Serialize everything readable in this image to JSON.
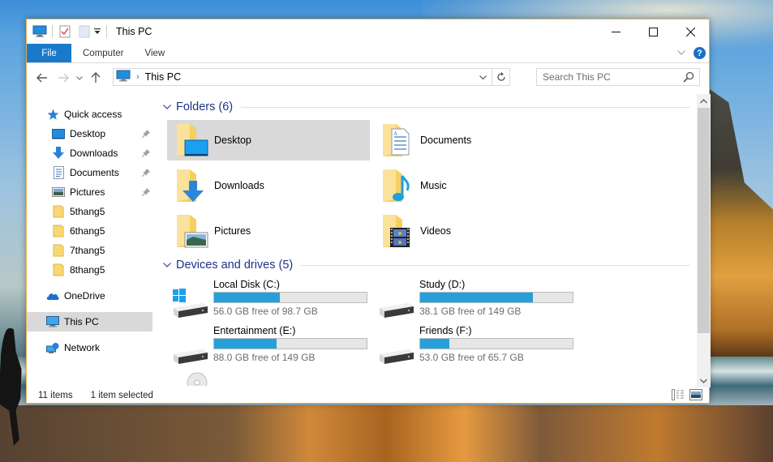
{
  "window": {
    "title": "This PC",
    "controls": {
      "minimize": "—",
      "maximize": "☐",
      "close": "✕"
    }
  },
  "ribbon": {
    "tabs": [
      {
        "label": "File",
        "active": true
      },
      {
        "label": "Computer"
      },
      {
        "label": "View"
      }
    ],
    "help_label": "?"
  },
  "address": {
    "breadcrumb": [
      "This PC"
    ],
    "search_placeholder": "Search This PC"
  },
  "navpane": {
    "quick_access": {
      "label": "Quick access"
    },
    "pinned": [
      {
        "label": "Desktop",
        "icon": "desktop-icon"
      },
      {
        "label": "Downloads",
        "icon": "download-arrow-icon"
      },
      {
        "label": "Documents",
        "icon": "document-icon"
      },
      {
        "label": "Pictures",
        "icon": "picture-icon"
      }
    ],
    "recent_folders": [
      {
        "label": "5thang5"
      },
      {
        "label": "6thang5"
      },
      {
        "label": "7thang5"
      },
      {
        "label": "8thang5"
      }
    ],
    "onedrive": {
      "label": "OneDrive"
    },
    "this_pc": {
      "label": "This PC",
      "selected": true
    },
    "network": {
      "label": "Network"
    }
  },
  "content": {
    "folders_group": {
      "title": "Folders (6)"
    },
    "folders": [
      {
        "label": "Desktop",
        "selected": true,
        "overlay": "desktop"
      },
      {
        "label": "Documents",
        "overlay": "document"
      },
      {
        "label": "Downloads",
        "overlay": "download"
      },
      {
        "label": "Music",
        "overlay": "music"
      },
      {
        "label": "Pictures",
        "overlay": "picture"
      },
      {
        "label": "Videos",
        "overlay": "video"
      }
    ],
    "drives_group": {
      "title": "Devices and drives (5)"
    },
    "drives": [
      {
        "name": "Local Disk (C:)",
        "free_text": "56.0 GB free of 98.7 GB",
        "used_fraction": 0.43,
        "system": true
      },
      {
        "name": "Study (D:)",
        "free_text": "38.1 GB free of 149 GB",
        "used_fraction": 0.74
      },
      {
        "name": "Entertainment (E:)",
        "free_text": "88.0 GB free of 149 GB",
        "used_fraction": 0.41
      },
      {
        "name": "Friends (F:)",
        "free_text": "53.0 GB free of 65.7 GB",
        "used_fraction": 0.19
      }
    ]
  },
  "statusbar": {
    "item_count": "11 items",
    "selection": "1 item selected"
  },
  "colors": {
    "accent": "#1979ca",
    "group_header": "#1e3287",
    "drive_bar_fill": "#26a0da",
    "selection_bg": "#d9d9d9",
    "folder_yellow": "#f8d775"
  }
}
